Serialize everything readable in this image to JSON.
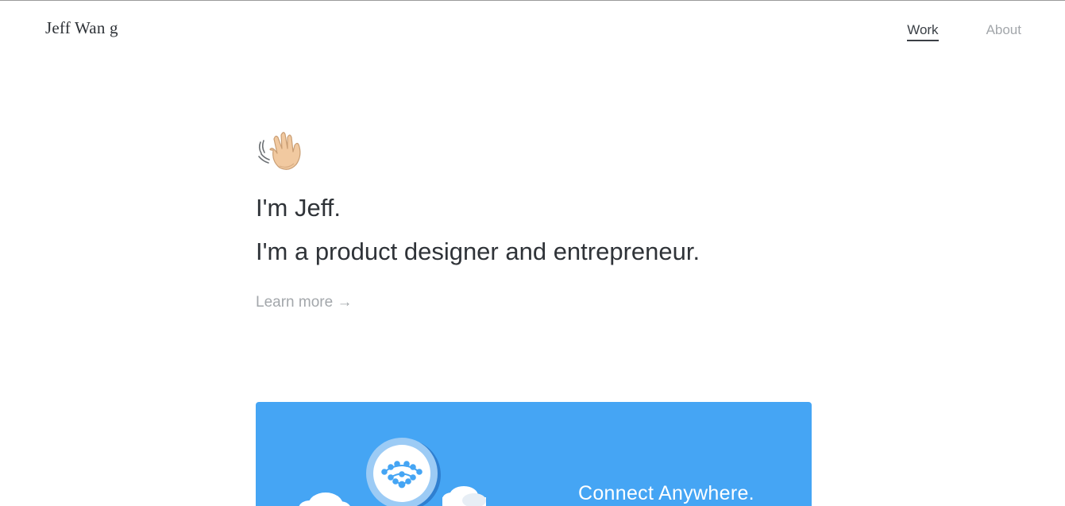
{
  "header": {
    "logo_text": "Jeff Wan g",
    "nav": [
      {
        "label": "Work",
        "active": true
      },
      {
        "label": "About",
        "active": false
      }
    ]
  },
  "hero": {
    "icon": "waving-hand-icon",
    "greeting": "I'm Jeff.",
    "tagline": "I'm a product designer and entrepreneur.",
    "learn_more": "Learn more →"
  },
  "project_card": {
    "title": "Connect Anywhere.",
    "background_color": "#45a5f4",
    "icons": [
      "wifi-mesh-icon",
      "cloud-icon"
    ]
  },
  "colors": {
    "text_primary": "#2f3338",
    "text_muted": "#a3a7ab",
    "accent": "#45a5f4"
  }
}
